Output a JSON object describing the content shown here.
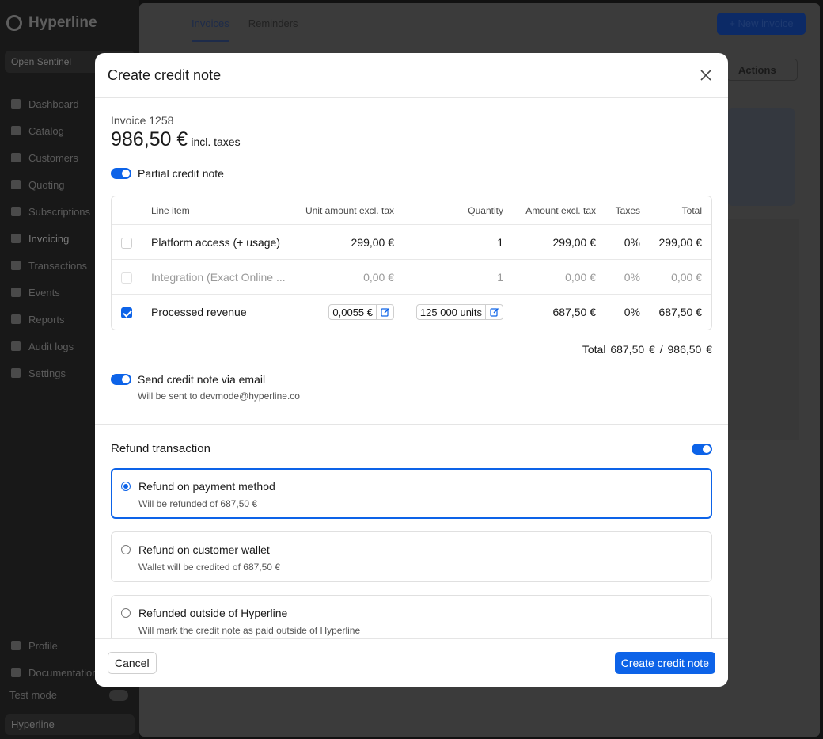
{
  "app": {
    "brand": "Hyperline",
    "org": "Open Sentinel",
    "nav": [
      "Dashboard",
      "Catalog",
      "Customers",
      "Quoting",
      "Subscriptions",
      "Invoicing",
      "Transactions",
      "Events",
      "Reports",
      "Audit logs",
      "Settings"
    ],
    "bottom_nav": [
      "Profile",
      "Documentation"
    ],
    "test_mode": "Test mode",
    "workspace": "Hyperline",
    "tabs": [
      "Invoices",
      "Reminders"
    ],
    "new_invoice": "+ New invoice",
    "actions": "Actions"
  },
  "modal": {
    "title": "Create credit note",
    "invoice_label": "Invoice 1258",
    "invoice_amount": "986,50 €",
    "invoice_suffix": "incl. taxes",
    "partial_label": "Partial credit note",
    "table": {
      "headers": [
        "Line item",
        "Unit amount excl. tax",
        "Quantity",
        "Amount excl. tax",
        "Taxes",
        "Total"
      ],
      "rows": [
        {
          "item": "Platform access (+ usage)",
          "unit": "299,00 €",
          "qty": "1",
          "amount": "299,00 €",
          "tax": "0%",
          "total": "299,00 €"
        },
        {
          "item": "Integration (Exact Online ...",
          "unit": "0,00 €",
          "qty": "1",
          "amount": "0,00 €",
          "tax": "0%",
          "total": "0,00 €"
        },
        {
          "item": "Processed revenue",
          "unit": "0,0055 €",
          "qty": "125 000 units",
          "amount": "687,50 €",
          "tax": "0%",
          "total": "687,50 €"
        }
      ]
    },
    "total_label": "Total",
    "total_value": "687,50 €",
    "total_sep": "/",
    "total_of": "986,50 €",
    "email_label": "Send credit note via email",
    "email_sub": "Will be sent to devmode@hyperline.co",
    "refund_title": "Refund transaction",
    "options": [
      {
        "title": "Refund on payment method",
        "desc": "Will be refunded of 687,50 €"
      },
      {
        "title": "Refund on customer wallet",
        "desc": "Wallet will be credited of 687,50 €"
      },
      {
        "title": "Refunded outside of Hyperline",
        "desc": "Will mark the credit note as paid outside of Hyperline"
      }
    ],
    "cancel": "Cancel",
    "submit": "Create credit note"
  },
  "colors": {
    "accent": "#0d63e8"
  }
}
